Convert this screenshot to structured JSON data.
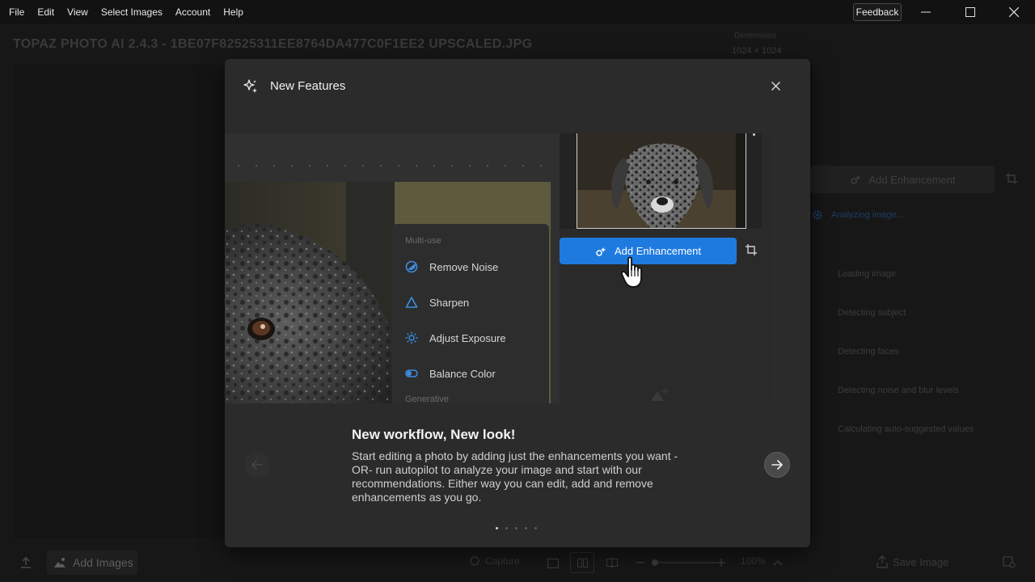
{
  "menubar": {
    "items": [
      "File",
      "Edit",
      "View",
      "Select Images",
      "Account",
      "Help"
    ],
    "feedback_label": "Feedback"
  },
  "background_app": {
    "title": "TOPAZ PHOTO AI 2.4.3 - 1BE07F82525311EE8764DA477C0F1EE2 UPSCALED.JPG",
    "dims_label": "Dimensions",
    "dims_value": "1024 × 1024",
    "add_enhancement_label": "Add Enhancement",
    "analyzing_label": "Analyzing image...",
    "analysis_steps": [
      "Loading image",
      "Detecting subject",
      "Detecting faces",
      "Detecting noise and blur levels",
      "Calculating auto-suggested values"
    ],
    "add_images_label": "Add Images",
    "capture_label": "Capture",
    "zoom_label": "100%",
    "save_image_label": "Save Image"
  },
  "modal": {
    "title": "New Features",
    "media": {
      "multi_use_label": "Multi-use",
      "generative_label": "Generative",
      "menu_items": [
        {
          "label": "Remove Noise",
          "icon": "remove-noise-icon"
        },
        {
          "label": "Sharpen",
          "icon": "sharpen-icon"
        },
        {
          "label": "Adjust Exposure",
          "icon": "adjust-exposure-icon"
        },
        {
          "label": "Balance Color",
          "icon": "balance-color-icon"
        }
      ],
      "add_enhancement_label": "Add Enhancement"
    },
    "slide": {
      "title": "New workflow, New look!",
      "description": "Start editing a photo by adding just the enhancements you want -OR- run autopilot to analyze your image and start with our recommendations. Either way you can edit, add and remove enhancements as you go.",
      "total_slides": 5,
      "current_slide": 1
    }
  },
  "colors": {
    "accent": "#1f7ae0",
    "modal_bg": "#2b2b2b",
    "app_bg": "#171717"
  }
}
